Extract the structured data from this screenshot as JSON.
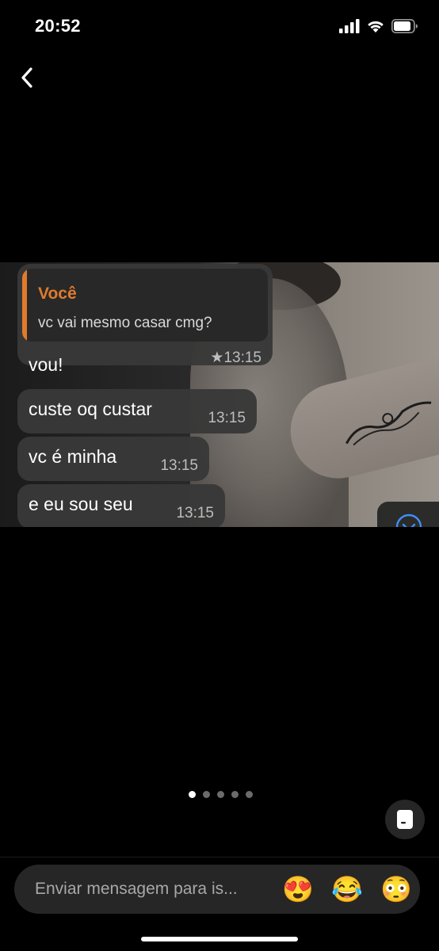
{
  "status_bar": {
    "time": "20:52",
    "signal_icon": "cellular-signal-icon",
    "wifi_icon": "wifi-icon",
    "battery_icon": "battery-icon"
  },
  "header": {
    "back_icon": "chevron-left-icon"
  },
  "media": {
    "reply": {
      "author": "Você",
      "text": "vc vai mesmo casar cmg?"
    },
    "messages": [
      {
        "text": "vou!",
        "time": "★13:15"
      },
      {
        "text": "custe oq custar",
        "time": "13:15"
      },
      {
        "text": "vc é minha",
        "time": "13:15"
      },
      {
        "text": "e eu sou seu",
        "time": "13:15"
      }
    ],
    "scroll_icon": "chevron-down-circle-icon",
    "accent_color": "#e07b2c"
  },
  "pager": {
    "total": 5,
    "active_index": 0
  },
  "sticker_button_icon": "sticker-icon",
  "composer": {
    "placeholder": "Enviar mensagem para is...",
    "emojis": [
      "😍",
      "😂",
      "😳"
    ]
  }
}
